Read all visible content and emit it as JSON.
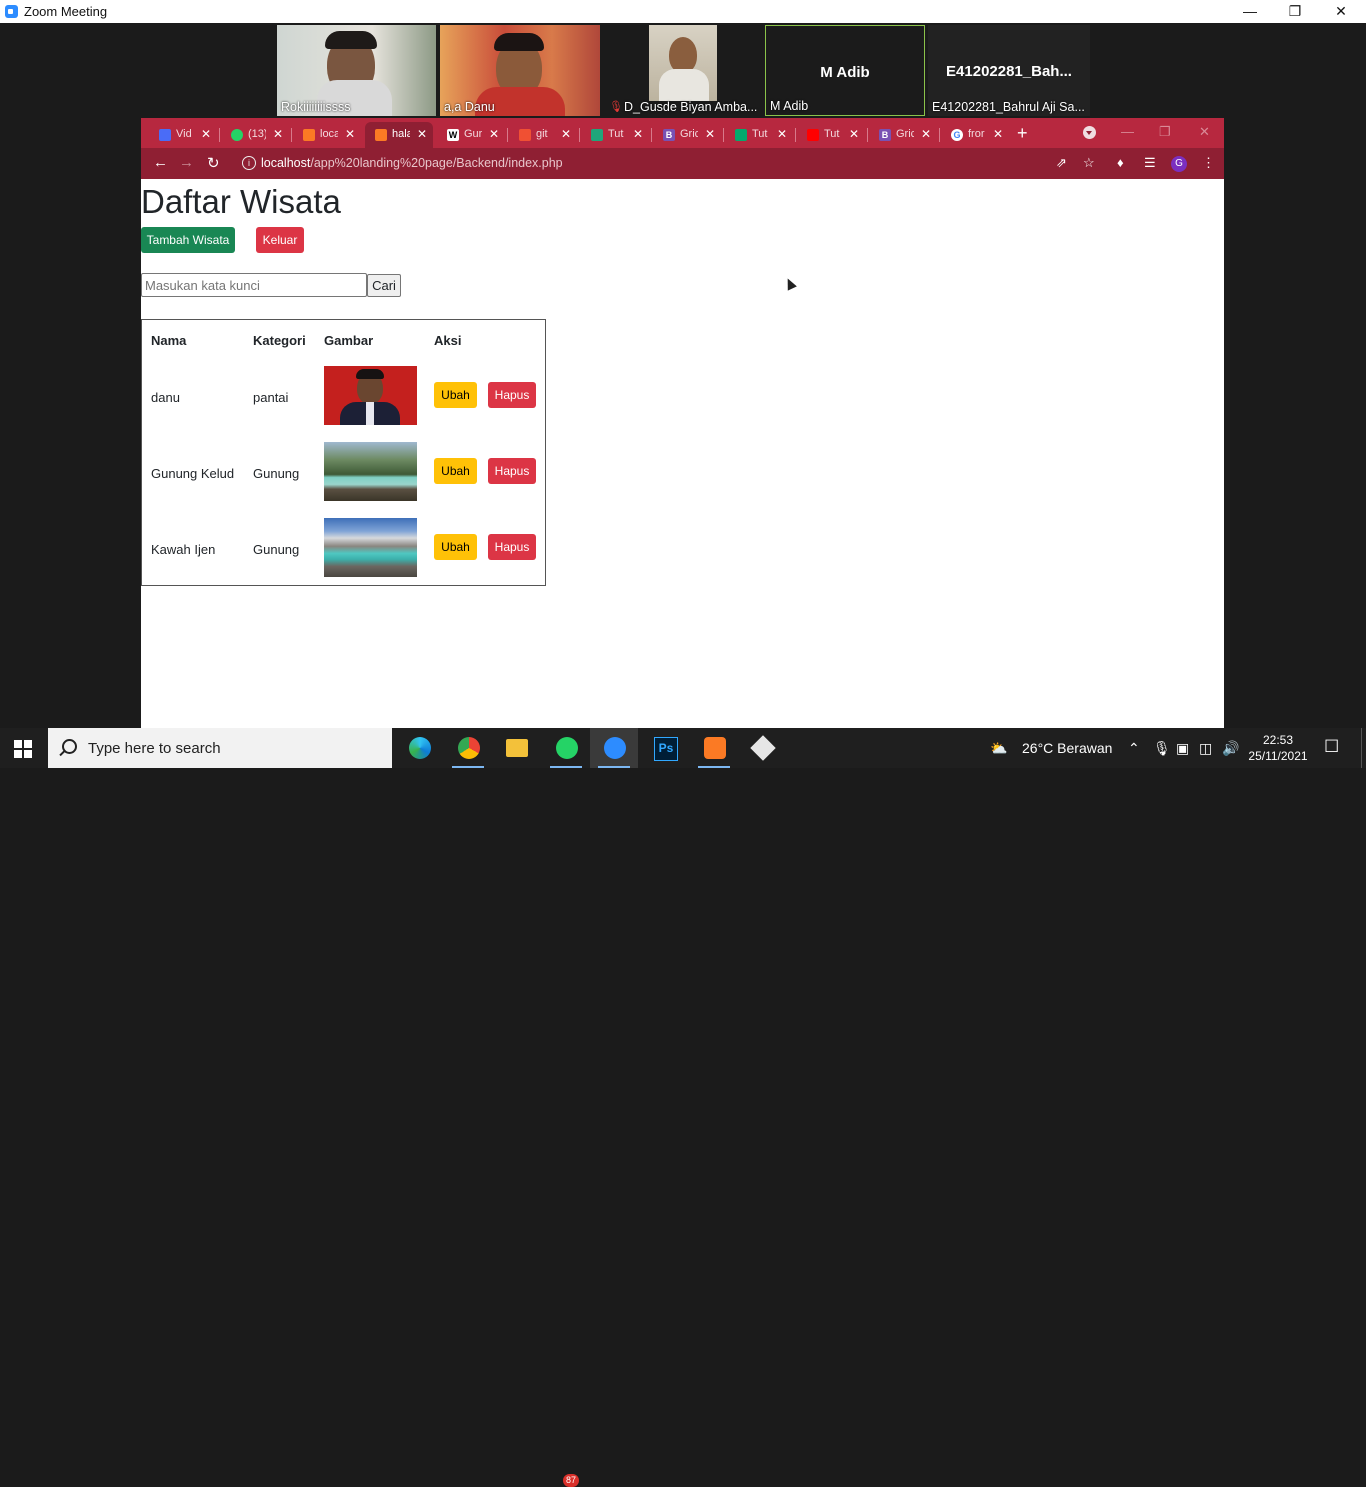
{
  "zoom": {
    "title": "Zoom Meeting",
    "participants": [
      {
        "name": "Rokiiiiiiiissss"
      },
      {
        "name": "a,a Danu"
      },
      {
        "name": "D_Gusde Biyan Amba..."
      },
      {
        "name": "M Adib",
        "display_name": "M Adib"
      },
      {
        "name": "E41202281_Bahrul Aji Sa...",
        "display_name": "E41202281_Bah..."
      }
    ]
  },
  "browser": {
    "tabs": [
      {
        "label": "Vid",
        "icon": "zoom-icon"
      },
      {
        "label": "(13)",
        "icon": "whatsapp-icon"
      },
      {
        "label": "loca",
        "icon": "xampp-icon"
      },
      {
        "label": "hala",
        "icon": "xampp-icon"
      },
      {
        "label": "Gur",
        "icon": "wikipedia-icon"
      },
      {
        "label": "git",
        "icon": "git-icon"
      },
      {
        "label": "Tut",
        "icon": "tutorial-icon"
      },
      {
        "label": "Gric",
        "icon": "bootstrap-icon"
      },
      {
        "label": "Tut",
        "icon": "w3schools-icon"
      },
      {
        "label": "Tut",
        "icon": "youtube-icon"
      },
      {
        "label": "Gric",
        "icon": "bootstrap-icon"
      },
      {
        "label": "fror",
        "icon": "google-icon"
      }
    ],
    "url_host": "localhost",
    "url_path": "/app%20landing%20page/Backend/index.php",
    "profile_initial": "G"
  },
  "page": {
    "title": "Daftar Wisata",
    "add_label": "Tambah Wisata",
    "logout_label": "Keluar",
    "search_placeholder": "Masukan kata kunci",
    "search_label": "Cari",
    "headers": {
      "nama": "Nama",
      "kategori": "Kategori",
      "gambar": "Gambar",
      "aksi": "Aksi"
    },
    "rows": [
      {
        "nama": "danu",
        "kategori": "pantai",
        "edit": "Ubah",
        "delete": "Hapus"
      },
      {
        "nama": "Gunung Kelud",
        "kategori": "Gunung",
        "edit": "Ubah",
        "delete": "Hapus"
      },
      {
        "nama": "Kawah Ijen",
        "kategori": "Gunung",
        "edit": "Ubah",
        "delete": "Hapus"
      }
    ]
  },
  "taskbar": {
    "search_placeholder": "Type here to search",
    "whatsapp_badge": "87",
    "weather": "26°C  Berawan",
    "time": "22:53",
    "date": "25/11/2021"
  }
}
